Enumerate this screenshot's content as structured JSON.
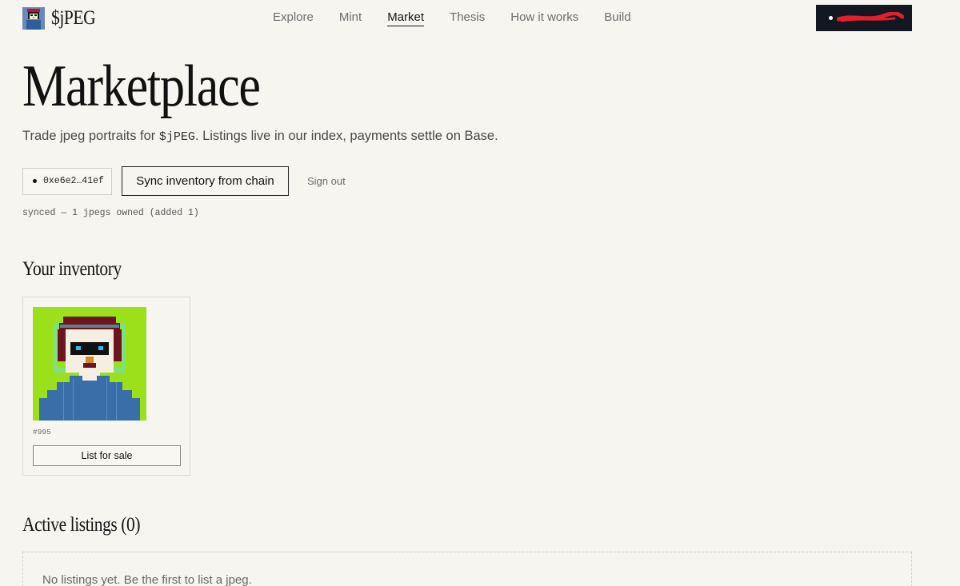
{
  "header": {
    "brand_name": "$jPEG",
    "nav": [
      {
        "label": "Explore",
        "active": false
      },
      {
        "label": "Mint",
        "active": false
      },
      {
        "label": "Market",
        "active": true
      },
      {
        "label": "Thesis",
        "active": false
      },
      {
        "label": "How it works",
        "active": false
      },
      {
        "label": "Build",
        "active": false
      }
    ],
    "wallet_button": {
      "label": "",
      "redacted": true
    }
  },
  "page": {
    "title": "Marketplace",
    "subtitle_before": "Trade jpeg portraits for ",
    "subtitle_code": "$jPEG",
    "subtitle_after": ". Listings live in our index, payments settle on Base."
  },
  "controls": {
    "address_chip": "0xe6e2…41ef",
    "sync_button": "Sync inventory from chain",
    "sign_out": "Sign out",
    "sync_status": "synced — 1 jpegs owned (added 1)"
  },
  "inventory": {
    "title": "Your inventory",
    "items": [
      {
        "id": "#995",
        "action_label": "List for sale"
      }
    ]
  },
  "listings": {
    "title": "Active listings (0)",
    "empty_text": "No listings yet. Be the first to list a jpeg."
  },
  "colors": {
    "background": "#f6f5f0",
    "wallet_button_bg": "#121722",
    "redaction": "#e0202a",
    "portrait_bg": "#9be01a",
    "portrait_shirt": "#3a6ea8",
    "portrait_hair": "#6e1420"
  }
}
